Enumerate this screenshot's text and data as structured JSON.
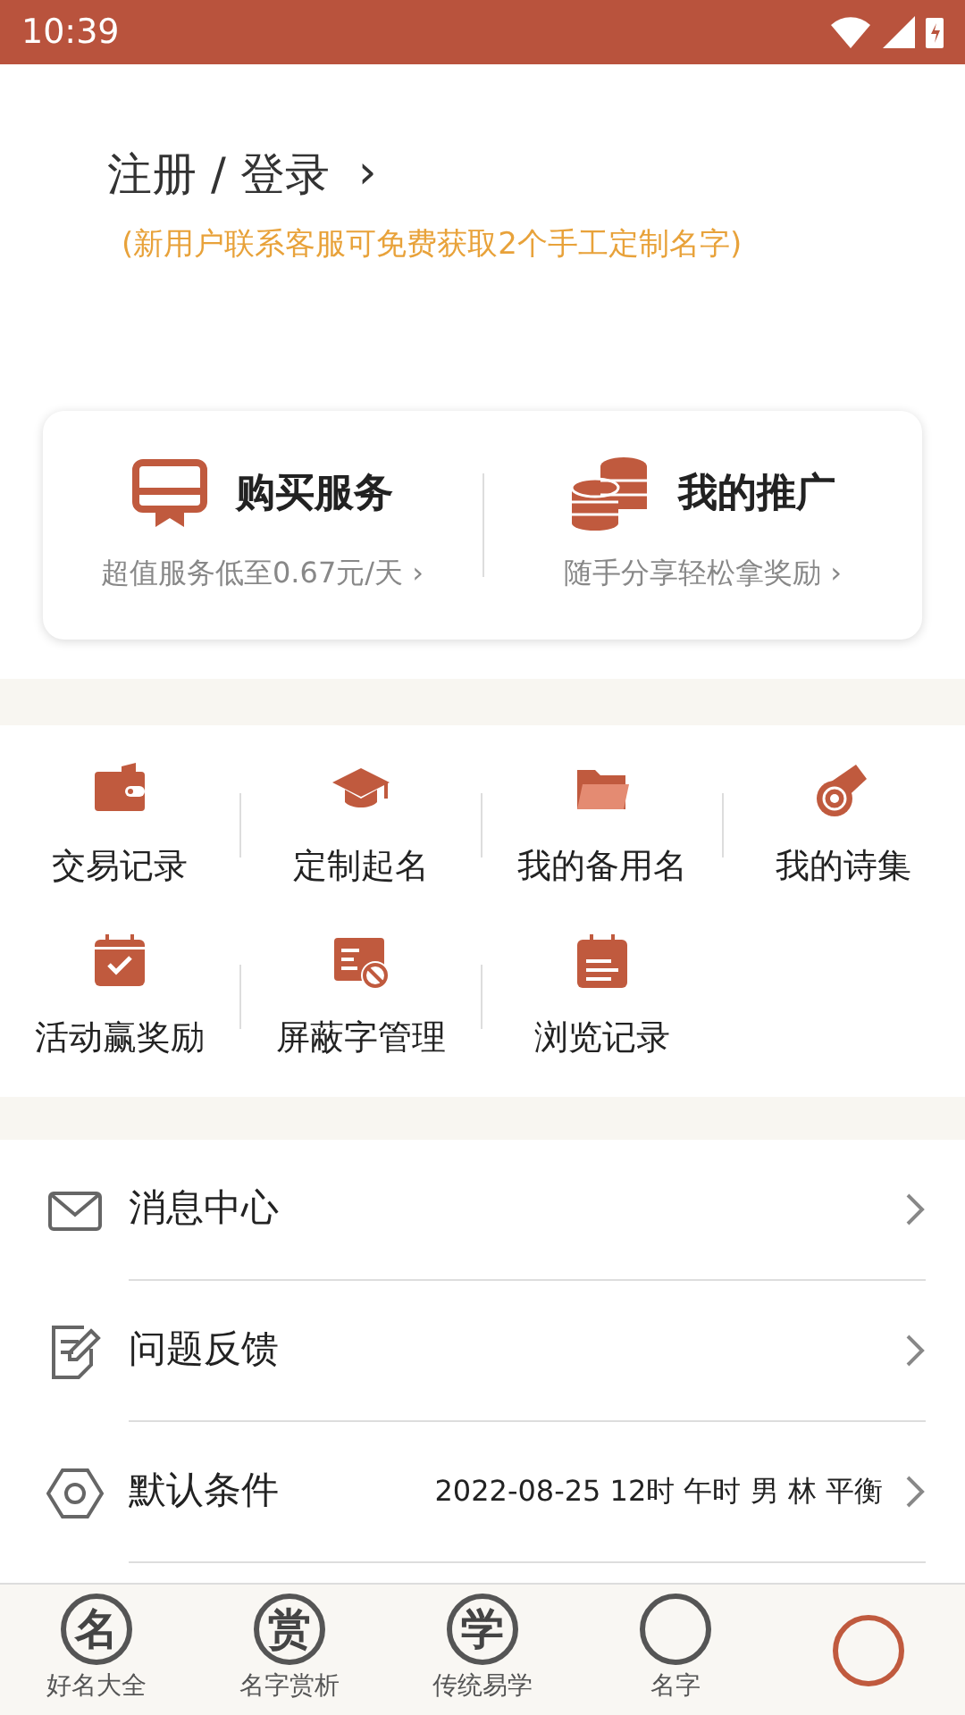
{
  "status_bar": {
    "time": "10:39"
  },
  "login": {
    "title": "注册 / 登录",
    "arrow": "›",
    "promo": "(新用户联系客服可免费获取2个手工定制名字)"
  },
  "cards": [
    {
      "kind": "ticket",
      "title": "购买服务",
      "subtitle": "超值服务低至0.67元/天 ›"
    },
    {
      "kind": "coins",
      "title": "我的推广",
      "subtitle": "随手分享轻松拿奖励 ›"
    }
  ],
  "grid": [
    {
      "kind": "wallet",
      "label": "交易记录"
    },
    {
      "kind": "cap",
      "label": "定制起名"
    },
    {
      "kind": "folder",
      "label": "我的备用名"
    },
    {
      "kind": "scroll",
      "label": "我的诗集"
    },
    {
      "kind": "calendar",
      "label": "活动赢奖励"
    },
    {
      "kind": "block",
      "label": "屏蔽字管理"
    },
    {
      "kind": "notes",
      "label": "浏览记录"
    }
  ],
  "menu": [
    {
      "kind": "mail",
      "label": "消息中心"
    },
    {
      "kind": "edit",
      "label": "问题反馈"
    },
    {
      "kind": "hex",
      "label": "默认条件",
      "value": "2022-08-25 12时 午时 男 林 平衡"
    }
  ],
  "tabs": [
    {
      "glyph": "名",
      "label": "好名大全",
      "selected": false
    },
    {
      "glyph": "赏",
      "label": "名字赏析",
      "selected": false
    },
    {
      "glyph": "学",
      "label": "传统易学",
      "selected": false
    },
    {
      "label": "名字",
      "selected": false
    },
    {
      "selected": true
    }
  ]
}
